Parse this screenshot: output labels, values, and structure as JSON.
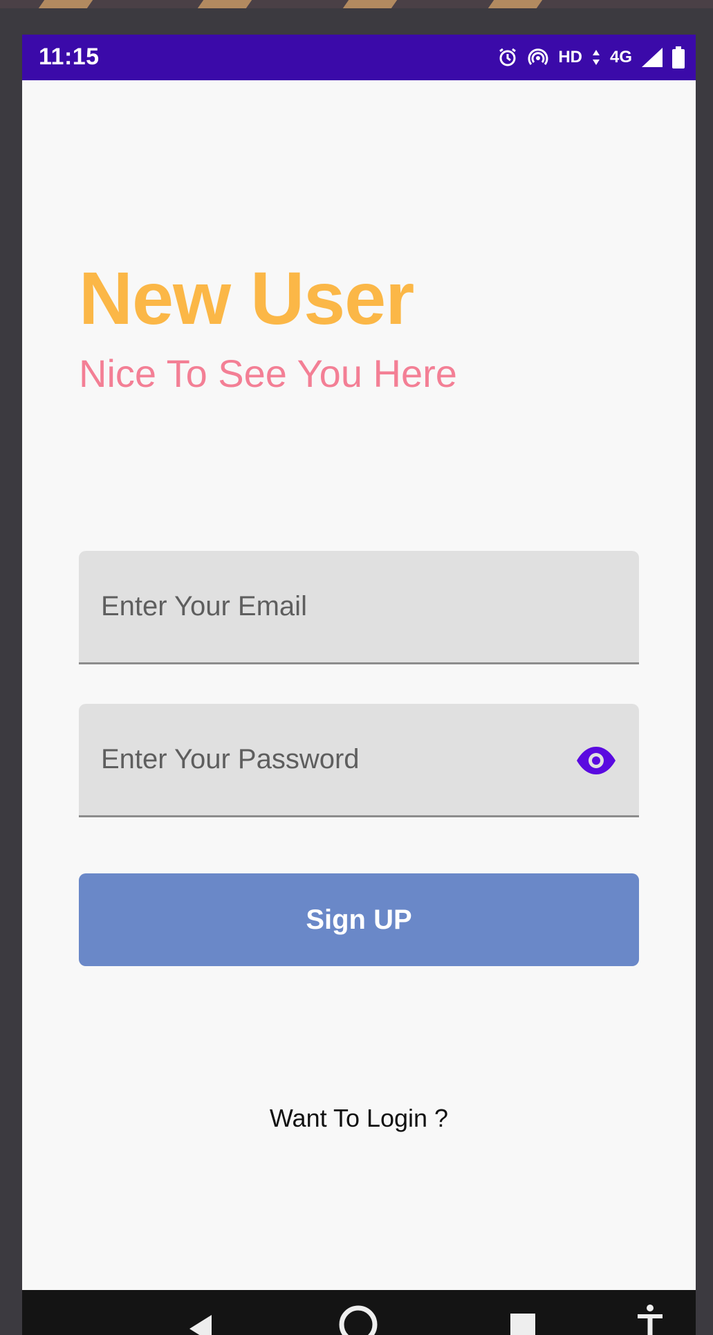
{
  "status_bar": {
    "time": "11:15",
    "hd_label": "HD",
    "network_label": "4G",
    "icons": [
      "alarm-icon",
      "hotspot-icon",
      "data-arrows-icon",
      "signal-icon",
      "battery-icon"
    ]
  },
  "header": {
    "title": "New User",
    "subtitle": "Nice To See You Here"
  },
  "form": {
    "email_placeholder": "Enter Your Email",
    "email_value": "",
    "password_placeholder": "Enter Your Password",
    "password_value": "",
    "signup_label": "Sign UP"
  },
  "footer": {
    "login_link": "Want To Login ?"
  },
  "navigation": {
    "icons": [
      "back-icon",
      "home-icon",
      "recents-icon",
      "accessibility-icon"
    ]
  },
  "colors": {
    "status_bar": "#3b0aa9",
    "title": "#fbb747",
    "subtitle": "#f37f95",
    "button": "#6a88c8",
    "eye_icon": "#5a0ae0"
  }
}
